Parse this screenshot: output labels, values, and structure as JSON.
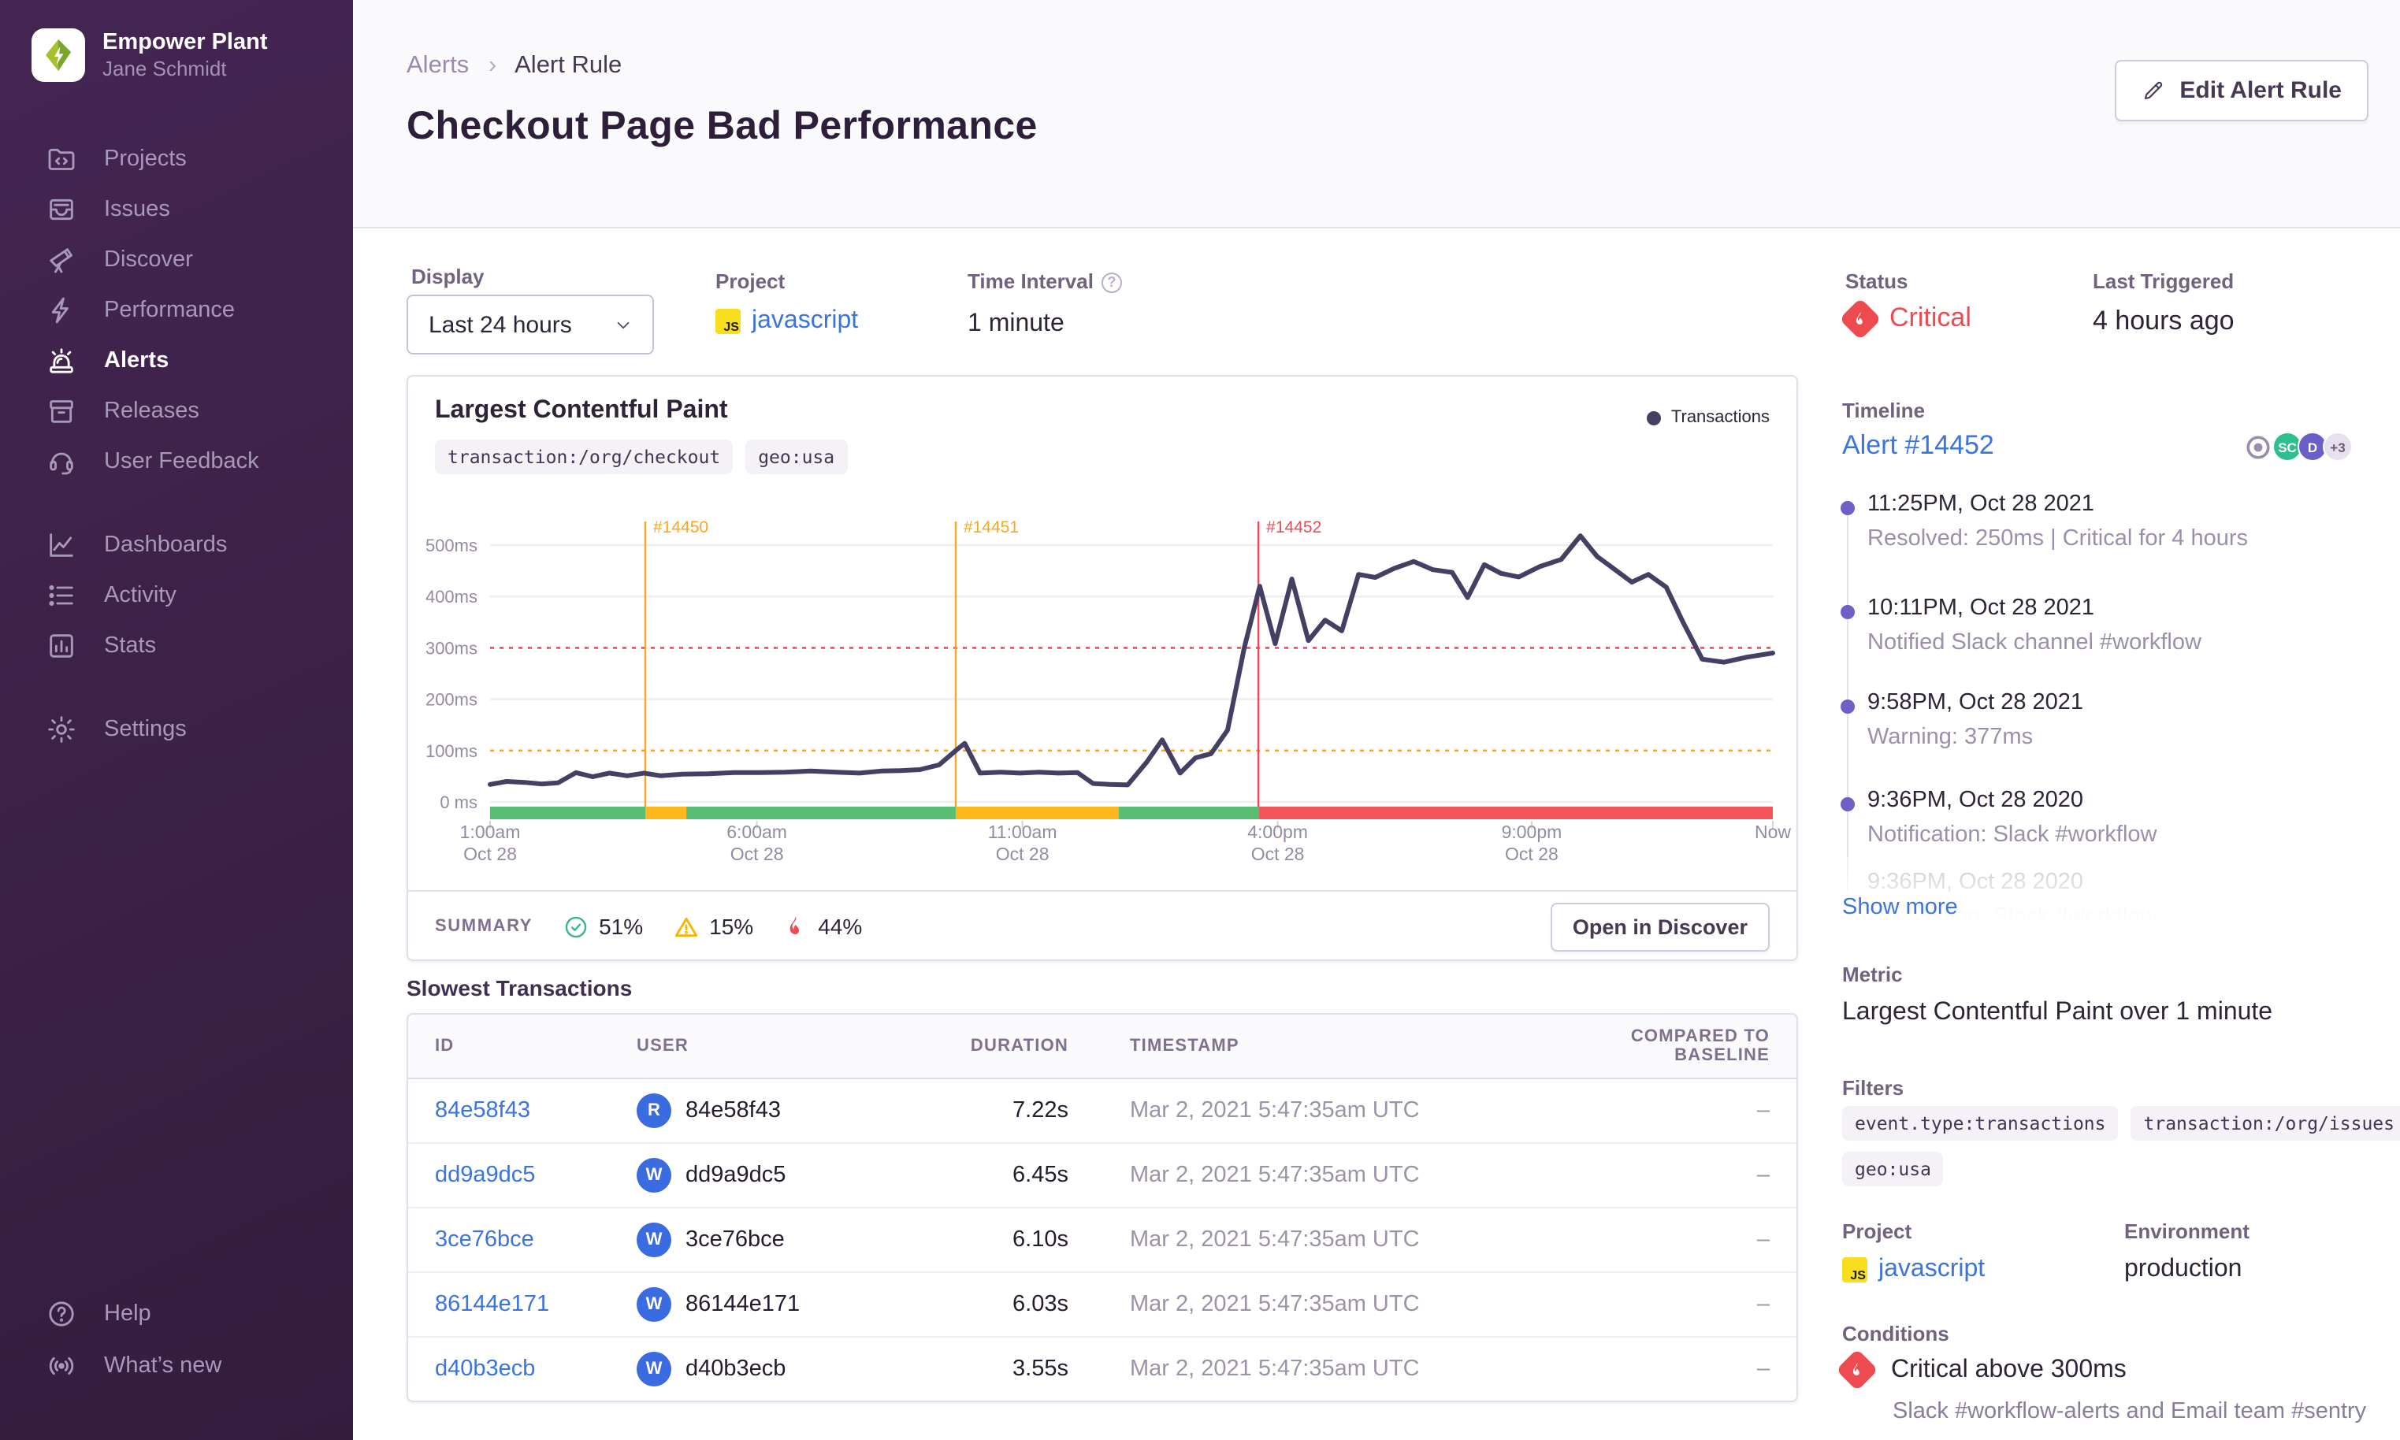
{
  "sidebar": {
    "org_name": "Empower Plant",
    "user_name": "Jane Schmidt",
    "items": [
      {
        "label": "Projects"
      },
      {
        "label": "Issues"
      },
      {
        "label": "Discover"
      },
      {
        "label": "Performance"
      },
      {
        "label": "Alerts",
        "active": true
      },
      {
        "label": "Releases"
      },
      {
        "label": "User Feedback"
      },
      {
        "label": "Dashboards"
      },
      {
        "label": "Activity"
      },
      {
        "label": "Stats"
      },
      {
        "label": "Settings"
      },
      {
        "label": "Help"
      },
      {
        "label": "What’s new"
      }
    ]
  },
  "header": {
    "breadcrumb": {
      "parent": "Alerts",
      "separator": "›",
      "current": "Alert Rule"
    },
    "title": "Checkout Page Bad Performance",
    "edit_button": "Edit Alert Rule"
  },
  "controls": {
    "display_label": "Display",
    "display_value": "Last 24 hours",
    "project_label": "Project",
    "project_value": "javascript",
    "project_badge": "JS",
    "interval_label": "Time Interval",
    "interval_help": "?",
    "interval_value": "1 minute"
  },
  "status": {
    "label": "Status",
    "value": "Critical",
    "color": "#ee4b51",
    "last_triggered_label": "Last Triggered",
    "last_triggered_value": "4 hours ago"
  },
  "chart_card": {
    "title": "Largest Contentful Paint",
    "tags": [
      "transaction:/org/checkout",
      "geo:usa"
    ],
    "legend": "Transactions",
    "summary_label": "SUMMARY",
    "summary": {
      "ok_pct": "51%",
      "warning_pct": "15%",
      "critical_pct": "44%"
    },
    "open_discover": "Open in Discover"
  },
  "chart_data": {
    "type": "line",
    "title": "Largest Contentful Paint",
    "ylabel": "ms",
    "ylim": [
      0,
      560
    ],
    "grid": true,
    "legend_position": "top-right",
    "y_ticks": [
      {
        "value": 500,
        "label": "500ms",
        "style": "solid"
      },
      {
        "value": 400,
        "label": "400ms",
        "style": "solid"
      },
      {
        "value": 300,
        "label": "300ms",
        "style": "critical"
      },
      {
        "value": 200,
        "label": "200ms",
        "style": "solid"
      },
      {
        "value": 100,
        "label": "100ms",
        "style": "warning"
      },
      {
        "value": 0,
        "label": "0 ms",
        "style": "solid"
      }
    ],
    "x_ticks": [
      {
        "frac": 0.0,
        "label": "1:00am",
        "sub": "Oct 28"
      },
      {
        "frac": 0.208,
        "label": "6:00am",
        "sub": "Oct 28"
      },
      {
        "frac": 0.415,
        "label": "11:00am",
        "sub": "Oct 28"
      },
      {
        "frac": 0.614,
        "label": "4:00pm",
        "sub": "Oct 28"
      },
      {
        "frac": 0.812,
        "label": "9:00pm",
        "sub": "Oct 28"
      },
      {
        "frac": 1.0,
        "label": "Now",
        "sub": ""
      }
    ],
    "incidents": [
      {
        "frac": 0.121,
        "label": "#14450",
        "severity": "warning"
      },
      {
        "frac": 0.363,
        "label": "#14451",
        "severity": "warning"
      },
      {
        "frac": 0.599,
        "label": "#14452",
        "severity": "critical"
      }
    ],
    "status_strip": [
      {
        "from": 0.0,
        "to": 0.121,
        "status": "ok"
      },
      {
        "from": 0.121,
        "to": 0.153,
        "status": "warning"
      },
      {
        "from": 0.153,
        "to": 0.363,
        "status": "ok"
      },
      {
        "from": 0.363,
        "to": 0.49,
        "status": "warning"
      },
      {
        "from": 0.49,
        "to": 0.599,
        "status": "ok"
      },
      {
        "from": 0.599,
        "to": 1.0,
        "status": "critical"
      }
    ],
    "series": [
      {
        "name": "Transactions",
        "color": "#444063",
        "points": [
          [
            0.0,
            34
          ],
          [
            0.013,
            40
          ],
          [
            0.027,
            38
          ],
          [
            0.04,
            35
          ],
          [
            0.053,
            37
          ],
          [
            0.067,
            57
          ],
          [
            0.08,
            49
          ],
          [
            0.093,
            56
          ],
          [
            0.107,
            51
          ],
          [
            0.12,
            56
          ],
          [
            0.133,
            51
          ],
          [
            0.15,
            54
          ],
          [
            0.17,
            55
          ],
          [
            0.19,
            57
          ],
          [
            0.21,
            57
          ],
          [
            0.23,
            58
          ],
          [
            0.25,
            60
          ],
          [
            0.27,
            58
          ],
          [
            0.288,
            56
          ],
          [
            0.305,
            60
          ],
          [
            0.32,
            61
          ],
          [
            0.335,
            63
          ],
          [
            0.35,
            72
          ],
          [
            0.363,
            100
          ],
          [
            0.37,
            114
          ],
          [
            0.382,
            56
          ],
          [
            0.398,
            58
          ],
          [
            0.413,
            56
          ],
          [
            0.428,
            58
          ],
          [
            0.443,
            56
          ],
          [
            0.458,
            57
          ],
          [
            0.47,
            36
          ],
          [
            0.483,
            34
          ],
          [
            0.497,
            33
          ],
          [
            0.512,
            78
          ],
          [
            0.524,
            121
          ],
          [
            0.538,
            56
          ],
          [
            0.55,
            86
          ],
          [
            0.562,
            94
          ],
          [
            0.575,
            140
          ],
          [
            0.588,
            300
          ],
          [
            0.6,
            420
          ],
          [
            0.612,
            308
          ],
          [
            0.625,
            434
          ],
          [
            0.638,
            314
          ],
          [
            0.651,
            354
          ],
          [
            0.664,
            333
          ],
          [
            0.677,
            443
          ],
          [
            0.69,
            437
          ],
          [
            0.705,
            455
          ],
          [
            0.72,
            468
          ],
          [
            0.735,
            452
          ],
          [
            0.75,
            447
          ],
          [
            0.762,
            398
          ],
          [
            0.775,
            462
          ],
          [
            0.788,
            445
          ],
          [
            0.802,
            438
          ],
          [
            0.818,
            458
          ],
          [
            0.835,
            472
          ],
          [
            0.85,
            518
          ],
          [
            0.863,
            478
          ],
          [
            0.877,
            452
          ],
          [
            0.89,
            428
          ],
          [
            0.903,
            443
          ],
          [
            0.917,
            418
          ],
          [
            0.93,
            350
          ],
          [
            0.945,
            278
          ],
          [
            0.962,
            272
          ],
          [
            0.98,
            282
          ],
          [
            1.0,
            290
          ]
        ]
      }
    ],
    "colors": {
      "ok": "#57be74",
      "warning": "#fdb71c",
      "critical": "#f4555b",
      "warning_line": "#f9a720",
      "critical_line": "#e84c5a",
      "grid": "#f0edf3",
      "axis_text": "#958aa3",
      "tick": "#d9d2e0"
    }
  },
  "table": {
    "title": "Slowest Transactions",
    "columns": [
      "ID",
      "USER",
      "DURATION",
      "TIMESTAMP",
      "COMPARED TO BASELINE"
    ],
    "rows": [
      {
        "id": "84e58f43",
        "avatar": "R",
        "user": "84e58f43",
        "duration": "7.22s",
        "timestamp": "Mar 2, 2021 5:47:35am UTC",
        "baseline": "–"
      },
      {
        "id": "dd9a9dc5",
        "avatar": "W",
        "user": "dd9a9dc5",
        "duration": "6.45s",
        "timestamp": "Mar 2, 2021 5:47:35am UTC",
        "baseline": "–"
      },
      {
        "id": "3ce76bce",
        "avatar": "W",
        "user": "3ce76bce",
        "duration": "6.10s",
        "timestamp": "Mar 2, 2021 5:47:35am UTC",
        "baseline": "–"
      },
      {
        "id": "86144e171",
        "avatar": "W",
        "user": "86144e171",
        "duration": "6.03s",
        "timestamp": "Mar 2, 2021 5:47:35am UTC",
        "baseline": "–"
      },
      {
        "id": "d40b3ecb",
        "avatar": "W",
        "user": "d40b3ecb",
        "duration": "3.55s",
        "timestamp": "Mar 2, 2021 5:47:35am UTC",
        "baseline": "–"
      }
    ]
  },
  "timeline": {
    "label": "Timeline",
    "alert_link": "Alert #14452",
    "avatars": [
      {
        "initials": "SC",
        "color": "#2fbf8f"
      },
      {
        "initials": "D",
        "color": "#6a5ec7"
      },
      {
        "initials": "+3",
        "color": "#e6e0ef",
        "text_color": "#6a5b77"
      }
    ],
    "entries": [
      {
        "time": "11:25PM, Oct 28 2021",
        "desc": "Resolved: 250ms | Critical for 4 hours"
      },
      {
        "time": "10:11PM, Oct 28 2021",
        "desc": "Notified Slack channel #workflow"
      },
      {
        "time": "9:58PM, Oct 28 2021",
        "desc": "Warning: 377ms"
      },
      {
        "time": "9:36PM, Oct 28 2020",
        "desc": "Notification: Slack #workflow"
      }
    ],
    "faded_entry": {
      "time": "9:36PM, Oct 28 2020",
      "desc": "Notification: Slack #workflow"
    },
    "show_more": "Show more"
  },
  "details": {
    "metric_label": "Metric",
    "metric_value": "Largest Contentful Paint over 1 minute",
    "filters_label": "Filters",
    "filters": [
      "event.type:transactions",
      "transaction:/org/issues",
      "geo:usa"
    ],
    "project_label": "Project",
    "project_value": "javascript",
    "project_badge": "JS",
    "environment_label": "Environment",
    "environment_value": "production",
    "conditions_label": "Conditions",
    "condition_title": "Critical above 300ms",
    "condition_desc": "Slack #workflow-alerts and Email team #sentry"
  }
}
